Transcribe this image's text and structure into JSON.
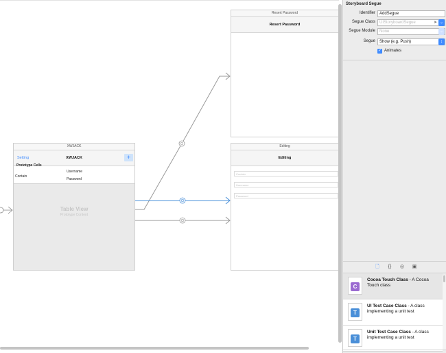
{
  "canvas": {
    "reset_scene": {
      "title": "Resert Password",
      "nav_title": "Resert Password"
    },
    "editing_scene": {
      "title": "Editing",
      "nav_title": "Editing",
      "fields": [
        "Contain",
        "Username",
        "Password"
      ]
    },
    "xwjack_scene": {
      "title": "XWJACK",
      "nav_left": "Setting",
      "nav_title": "XWJACK",
      "nav_right": "+",
      "section": "Prototype Cells",
      "cell_label": "Contain",
      "cell_username": "Username",
      "cell_password": "Password",
      "tableview_title": "Table View",
      "tableview_subtitle": "Prototype Content"
    }
  },
  "inspector": {
    "title": "Storyboard Segue",
    "identifier_label": "Identifier",
    "identifier_value": "AddSegue",
    "segue_class_label": "Segue Class",
    "segue_class_placeholder": "UIStoryboardSegue",
    "segue_module_label": "Segue Module",
    "segue_module_placeholder": "None",
    "segue_label": "Segue",
    "segue_value": "Show (e.g. Push)",
    "animates_label": "Animates"
  },
  "library": {
    "tabs": [
      "file-icon",
      "braces-icon",
      "object-icon",
      "media-icon"
    ],
    "items": [
      {
        "name": "Cocoa Touch Class",
        "desc": "A Cocoa Touch class",
        "icon_letter": "C",
        "color": "#9b6bd1"
      },
      {
        "name": "UI Test Case Class",
        "desc": "A class implementing a unit test",
        "icon_letter": "T",
        "color": "#4a8fd8"
      },
      {
        "name": "Unit Test Case Class",
        "desc": "A class implementing a unit test",
        "icon_letter": "T",
        "color": "#4a8fd8"
      }
    ]
  },
  "colors": {
    "accent": "#3f8bff",
    "segue_selected": "#4a90d9",
    "segue": "#9a9a9a"
  }
}
